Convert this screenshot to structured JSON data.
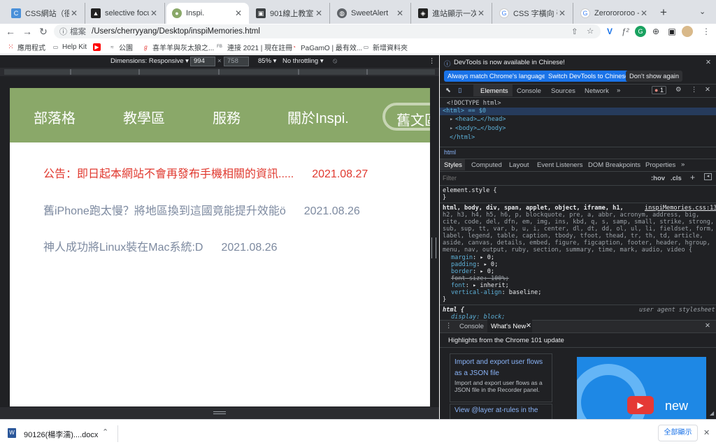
{
  "tabs": [
    {
      "title": "CSS網站（很多）|",
      "active": false
    },
    {
      "title": "selective focus pl",
      "active": false
    },
    {
      "title": "Inspi.",
      "active": true
    },
    {
      "title": "901線上教室",
      "active": false
    },
    {
      "title": "SweetAlert",
      "active": false
    },
    {
      "title": "進站顯示一次就好",
      "active": false
    },
    {
      "title": "CSS 字橫向 強制",
      "active": false
    },
    {
      "title": "Zerorororoo - Go",
      "active": false
    }
  ],
  "omnibox": {
    "scheme": "檔案",
    "url": "/Users/cherryyang/Desktop/inspiMemories.html"
  },
  "bookmarks": [
    "應用程式",
    "Help Kit",
    "公園",
    "喜羊羊與灰太狼之...",
    "連接 2021 | 現在註冊",
    "PaGamO | 最有效...",
    "新增資料夾"
  ],
  "bookmark_fb_tag": "FB",
  "device_toolbar": {
    "dimensions": "Dimensions: Responsive ▾",
    "width": "994",
    "height": "758",
    "zoom": "85% ▾",
    "throttle": "No throttling ▾"
  },
  "site": {
    "nav": [
      "部落格",
      "教學區",
      "服務",
      "關於Inspi.",
      "舊文區"
    ],
    "news": [
      {
        "text": "公告：即日起本網站不會再發布手機相關的資訊.....",
        "date": "2021.08.27",
        "color": "#e0392f"
      },
      {
        "text": "舊iPhone跑太慢？將地區換到這國竟能提升效能ö",
        "date": "2021.08.26",
        "color": "#7d8aa0"
      },
      {
        "text": "神人成功將Linux裝在Mac系統:D",
        "date": "2021.08.26",
        "color": "#7d8aa0"
      }
    ],
    "colors": {
      "nav_bg": "#8aa869",
      "nav_text": "#ffffff",
      "alert": "#e0392f",
      "muted": "#7d8aa0"
    }
  },
  "devtools": {
    "banner": "DevTools is now available in Chinese!",
    "btn_match": "Always match Chrome's language",
    "btn_switch": "Switch DevTools to Chinese",
    "btn_dismiss": "Don't show again",
    "main_tabs": [
      "Elements",
      "Console",
      "Sources",
      "Network"
    ],
    "error_count": "1",
    "dom": [
      "<!DOCTYPE html>",
      "<html> == $0",
      "<head>…</head>",
      "<body>…</body>",
      "</html>"
    ],
    "breadcrumb": "html",
    "style_tabs": [
      "Styles",
      "Computed",
      "Layout",
      "Event Listeners",
      "DOM Breakpoints",
      "Properties"
    ],
    "filter_placeholder": "Filter",
    "hov": ":hov",
    "cls": ".cls",
    "element_style": "element.style {",
    "close_brace": "}",
    "rule_source": "inspiMemories.css:13",
    "rule_selectors": [
      "html, body, div, span, applet, object, iframe, h1,",
      "h2, h3, h4, h5, h6, p, blockquote, pre, a, abbr, acronym, address, big,",
      "cite, code, del, dfn, em, img, ins, kbd, q, s, samp, small, strike, strong,",
      "sub, sup, tt, var, b, u, i, center, dl, dt, dd, ol, ul, li, fieldset, form,",
      "label, legend, table, caption, tbody, tfoot, thead, tr, th, td, article,",
      "aside, canvas, details, embed, figure, figcaption, footer, header, hgroup,",
      "menu, nav, output, ruby, section, summary, time, mark, audio, video {"
    ],
    "decls": [
      {
        "prop": "margin",
        "val": "▸ 0;"
      },
      {
        "prop": "padding",
        "val": "▸ 0;"
      },
      {
        "prop": "border",
        "val": "▸ 0;"
      },
      {
        "prop": "font-size",
        "val": "100%;"
      },
      {
        "prop": "font",
        "val": "▸ inherit;"
      },
      {
        "prop": "vertical-align",
        "val": "baseline;"
      }
    ],
    "ua_selector": "html {",
    "ua_label": "user agent stylesheet",
    "ua_decl": "display: block;",
    "drawer_tabs": [
      "Console",
      "What's New"
    ],
    "highlights": "Highlights from the Chrome 101 update",
    "card1_title": "Import and export user flows as a JSON file",
    "card1_body": "Import and export user flows as a JSON file in the Recorder panel.",
    "card2_title": "View @layer at-rules in the",
    "video_text": "new"
  },
  "download": {
    "file": "90126(楊李濡)....docx",
    "show_all": "全部顯示"
  }
}
